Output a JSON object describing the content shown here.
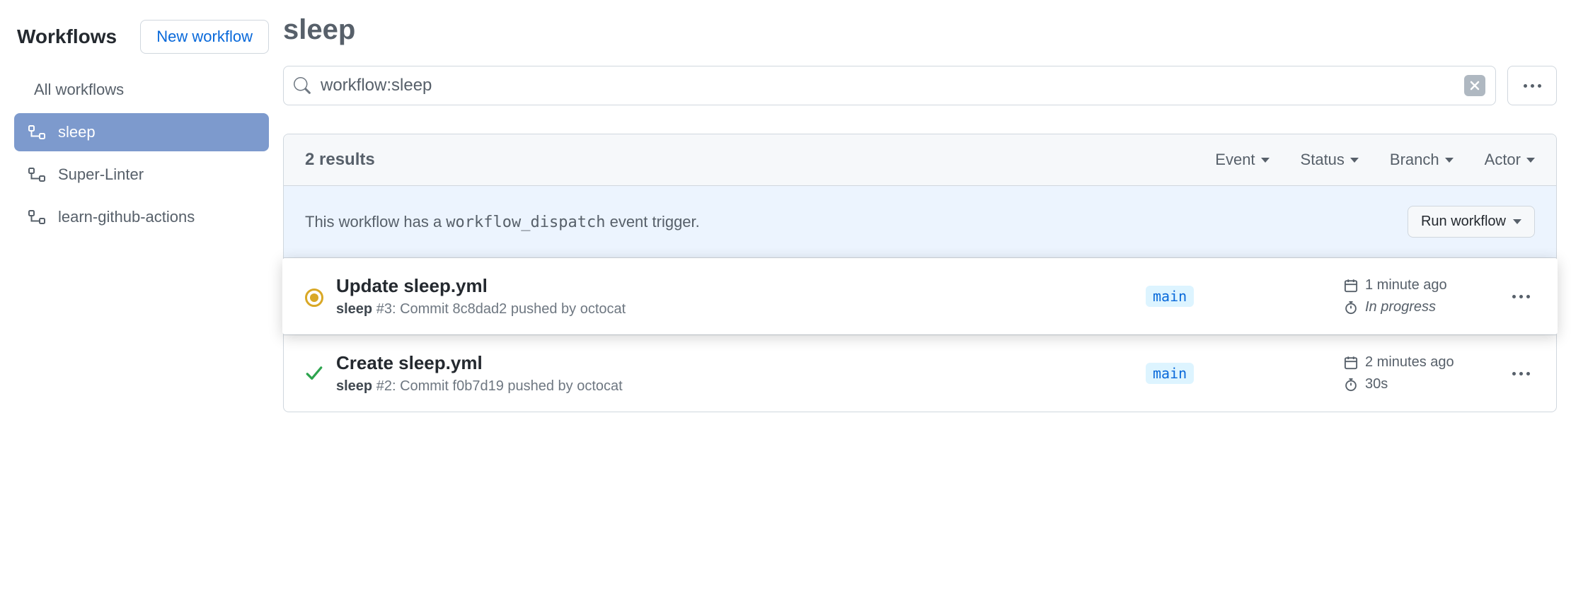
{
  "sidebar": {
    "title": "Workflows",
    "new_workflow_label": "New workflow",
    "all_label": "All workflows",
    "items": [
      {
        "label": "sleep",
        "active": true
      },
      {
        "label": "Super-Linter",
        "active": false
      },
      {
        "label": "learn-github-actions",
        "active": false
      }
    ]
  },
  "page": {
    "title": "sleep"
  },
  "search": {
    "value": "workflow:sleep"
  },
  "results": {
    "count_label": "2 results",
    "filters": {
      "event": "Event",
      "status": "Status",
      "branch": "Branch",
      "actor": "Actor"
    }
  },
  "dispatch": {
    "text_prefix": "This workflow has a ",
    "code": "workflow_dispatch",
    "text_suffix": " event trigger.",
    "run_label": "Run workflow"
  },
  "runs": [
    {
      "status": "running",
      "title": "Update sleep.yml",
      "workflow": "sleep",
      "run_number": "#3",
      "sub_prefix": ": Commit ",
      "commit": "8c8dad2",
      "sub_mid": " pushed by ",
      "actor": "octocat",
      "branch": "main",
      "time": "1 minute ago",
      "duration": "In progress",
      "highlight": true
    },
    {
      "status": "success",
      "title": "Create sleep.yml",
      "workflow": "sleep",
      "run_number": "#2",
      "sub_prefix": ": Commit ",
      "commit": "f0b7d19",
      "sub_mid": " pushed by ",
      "actor": "octocat",
      "branch": "main",
      "time": "2 minutes ago",
      "duration": "30s",
      "highlight": false
    }
  ]
}
